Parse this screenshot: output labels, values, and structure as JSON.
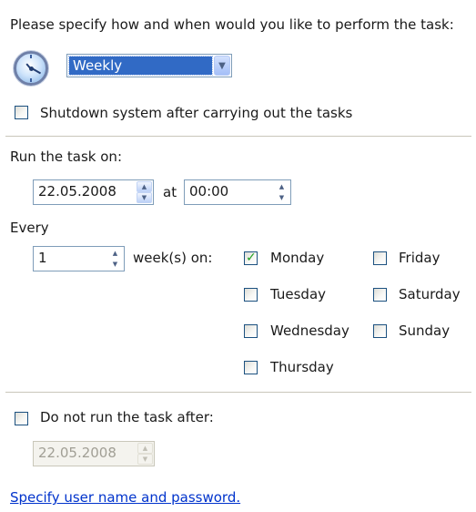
{
  "header": {
    "instruction": "Please specify how and when would you like to perform the task:",
    "schedule_type": "Weekly",
    "shutdown_label": "Shutdown system after carrying out the tasks",
    "shutdown_checked": false
  },
  "run": {
    "label": "Run the task on:",
    "date": "22.05.2008",
    "at_label": "at",
    "time": "00:00"
  },
  "every": {
    "label": "Every",
    "value": "1",
    "unit_label": "week(s) on:"
  },
  "days": [
    {
      "label": "Monday",
      "checked": true
    },
    {
      "label": "Tuesday",
      "checked": false
    },
    {
      "label": "Wednesday",
      "checked": false
    },
    {
      "label": "Thursday",
      "checked": false
    },
    {
      "label": "Friday",
      "checked": false
    },
    {
      "label": "Saturday",
      "checked": false
    },
    {
      "label": "Sunday",
      "checked": false
    }
  ],
  "end": {
    "label": "Do not run the task after:",
    "checked": false,
    "date": "22.05.2008"
  },
  "footer": {
    "link": "Specify user name and password."
  },
  "colors": {
    "selection": "#316ac5",
    "link": "#0033cc",
    "check": "#21a121",
    "checkbox_border": "#1c5180"
  },
  "icons": {
    "schedule": "clock-icon",
    "combo": "chevron-down-icon",
    "spinner": "spin-up-down-icon",
    "check": "check-mark-icon"
  }
}
